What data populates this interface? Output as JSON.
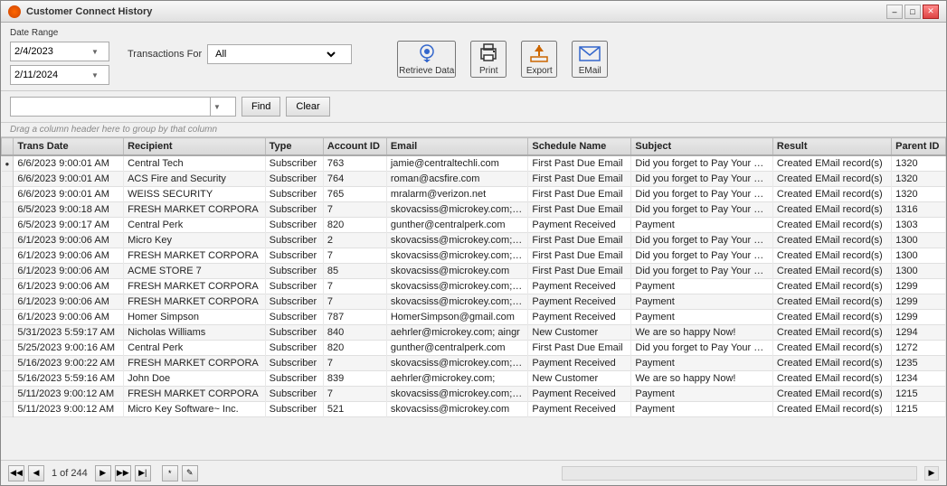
{
  "window": {
    "title": "Customer Connect History",
    "minimize_label": "–",
    "restore_label": "□",
    "close_label": "✕"
  },
  "toolbar": {
    "date_range_label": "Date Range",
    "date_start": "2/4/2023",
    "date_end": "2/11/2024",
    "transactions_label": "Transactions For",
    "transactions_value": "All",
    "retrieve_label": "Retrieve Data",
    "print_label": "Print",
    "export_label": "Export",
    "email_label": "EMail"
  },
  "search": {
    "find_label": "Find",
    "clear_label": "Clear",
    "placeholder": ""
  },
  "drag_hint": "Drag a column header here to group by that column",
  "table": {
    "columns": [
      "",
      "Trans Date",
      "Recipient",
      "Type",
      "Account ID",
      "Email",
      "Schedule Name",
      "Subject",
      "Result",
      "Parent ID"
    ],
    "rows": [
      [
        "",
        "6/6/2023 9:00:01 AM",
        "Central Tech",
        "Subscriber",
        "763",
        "jamie@centraltechli.com",
        "First Past Due Email",
        "Did you forget to Pay Your Monitoring Bill?",
        "Created EMail record(s)",
        "1320"
      ],
      [
        "",
        "6/6/2023 9:00:01 AM",
        "ACS Fire and Security",
        "Subscriber",
        "764",
        "roman@acsfire.com",
        "First Past Due Email",
        "Did you forget to Pay Your Monitoring Bill?",
        "Created EMail record(s)",
        "1320"
      ],
      [
        "",
        "6/6/2023 9:00:01 AM",
        "WEISS SECURITY",
        "Subscriber",
        "765",
        "mralarm@verizon.net",
        "First Past Due Email",
        "Did you forget to Pay Your Monitoring Bill?",
        "Created EMail record(s)",
        "1320"
      ],
      [
        "",
        "6/5/2023 9:00:18 AM",
        "FRESH MARKET CORPORA",
        "Subscriber",
        "7",
        "skovacsiss@microkey.com;ste",
        "First Past Due Email",
        "Did you forget to Pay Your Monitoring Bill?",
        "Created EMail record(s)",
        "1316"
      ],
      [
        "",
        "6/5/2023 9:00:17 AM",
        "Central Perk",
        "Subscriber",
        "820",
        "gunther@centralperk.com",
        "Payment Received",
        "Payment",
        "Created EMail record(s)",
        "1303"
      ],
      [
        "",
        "6/1/2023 9:00:06 AM",
        "Micro Key",
        "Subscriber",
        "2",
        "skovacsiss@microkey.com;ste",
        "First Past Due Email",
        "Did you forget to Pay Your Monitoring Bill?",
        "Created EMail record(s)",
        "1300"
      ],
      [
        "",
        "6/1/2023 9:00:06 AM",
        "FRESH MARKET CORPORA",
        "Subscriber",
        "7",
        "skovacsiss@microkey.com;ste",
        "First Past Due Email",
        "Did you forget to Pay Your Monitoring Bill?",
        "Created EMail record(s)",
        "1300"
      ],
      [
        "",
        "6/1/2023 9:00:06 AM",
        "ACME STORE 7",
        "Subscriber",
        "85",
        "skovacsiss@microkey.com",
        "First Past Due Email",
        "Did you forget to Pay Your Monitoring Bill?",
        "Created EMail record(s)",
        "1300"
      ],
      [
        "",
        "6/1/2023 9:00:06 AM",
        "FRESH MARKET CORPORA",
        "Subscriber",
        "7",
        "skovacsiss@microkey.com;ste",
        "Payment Received",
        "Payment",
        "Created EMail record(s)",
        "1299"
      ],
      [
        "",
        "6/1/2023 9:00:06 AM",
        "FRESH MARKET CORPORA",
        "Subscriber",
        "7",
        "skovacsiss@microkey.com;ste",
        "Payment Received",
        "Payment",
        "Created EMail record(s)",
        "1299"
      ],
      [
        "",
        "6/1/2023 9:00:06 AM",
        "Homer Simpson",
        "Subscriber",
        "787",
        "HomerSimpson@gmail.com",
        "Payment Received",
        "Payment",
        "Created EMail record(s)",
        "1299"
      ],
      [
        "",
        "5/31/2023 5:59:17 AM",
        "Nicholas Williams",
        "Subscriber",
        "840",
        "aehrler@microkey.com; aingr",
        "New Customer",
        "We are so happy Now!",
        "Created EMail record(s)",
        "1294"
      ],
      [
        "",
        "5/25/2023 9:00:16 AM",
        "Central Perk",
        "Subscriber",
        "820",
        "gunther@centralperk.com",
        "First Past Due Email",
        "Did you forget to Pay Your Monitoring Bill?",
        "Created EMail record(s)",
        "1272"
      ],
      [
        "",
        "5/16/2023 9:00:22 AM",
        "FRESH MARKET CORPORA",
        "Subscriber",
        "7",
        "skovacsiss@microkey.com;ste",
        "Payment Received",
        "Payment",
        "Created EMail record(s)",
        "1235"
      ],
      [
        "",
        "5/16/2023 5:59:16 AM",
        "John Doe",
        "Subscriber",
        "839",
        "aehrler@microkey.com;",
        "New Customer",
        "We are so happy Now!",
        "Created EMail record(s)",
        "1234"
      ],
      [
        "",
        "5/11/2023 9:00:12 AM",
        "FRESH MARKET CORPORA",
        "Subscriber",
        "7",
        "skovacsiss@microkey.com;ste",
        "Payment Received",
        "Payment",
        "Created EMail record(s)",
        "1215"
      ],
      [
        "",
        "5/11/2023 9:00:12 AM",
        "Micro Key Software~ Inc.",
        "Subscriber",
        "521",
        "skovacsiss@microkey.com",
        "Payment Received",
        "Payment",
        "Created EMail record(s)",
        "1215"
      ]
    ]
  },
  "footer": {
    "page_info": "1 of 244",
    "nav_first": "◀◀",
    "nav_prev": "◀",
    "nav_next": "▶",
    "nav_last": "▶▶",
    "nav_end": "▶|",
    "extra1": "*",
    "extra2": "✎"
  }
}
